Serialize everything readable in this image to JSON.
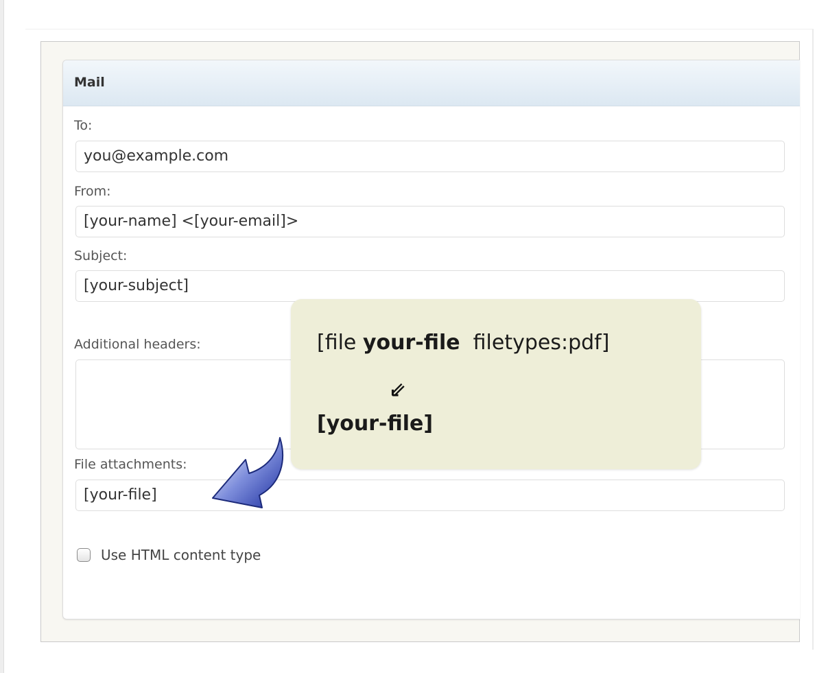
{
  "panel": {
    "title": "Mail"
  },
  "fields": {
    "to": {
      "label": "To:",
      "value": "you@example.com"
    },
    "from": {
      "label": "From:",
      "value": "[your-name] <[your-email]>"
    },
    "subject": {
      "label": "Subject:",
      "value": "[your-subject]"
    },
    "additional_headers": {
      "label": "Additional headers:",
      "value": ""
    },
    "file_attachments": {
      "label": "File attachments:",
      "value": "[your-file]"
    }
  },
  "html_content_type": {
    "label": "Use HTML content type",
    "checked": false
  },
  "tooltip": {
    "line1_prefix": "[file ",
    "line1_bold": "your-file",
    "line1_suffix": "  filetypes:pdf]",
    "arrow_glyph": "⇙",
    "line2": "[your-file]"
  },
  "colors": {
    "header_gradient_top": "#f2f7fb",
    "header_gradient_bottom": "#dce8f2",
    "tooltip_background": "#eeeed8",
    "arrow_fill": "#2b3fb0"
  },
  "icons": {
    "callout_arrow": "curved-arrow-icon",
    "tooltip_arrow": "down-left-double-arrow-icon"
  }
}
